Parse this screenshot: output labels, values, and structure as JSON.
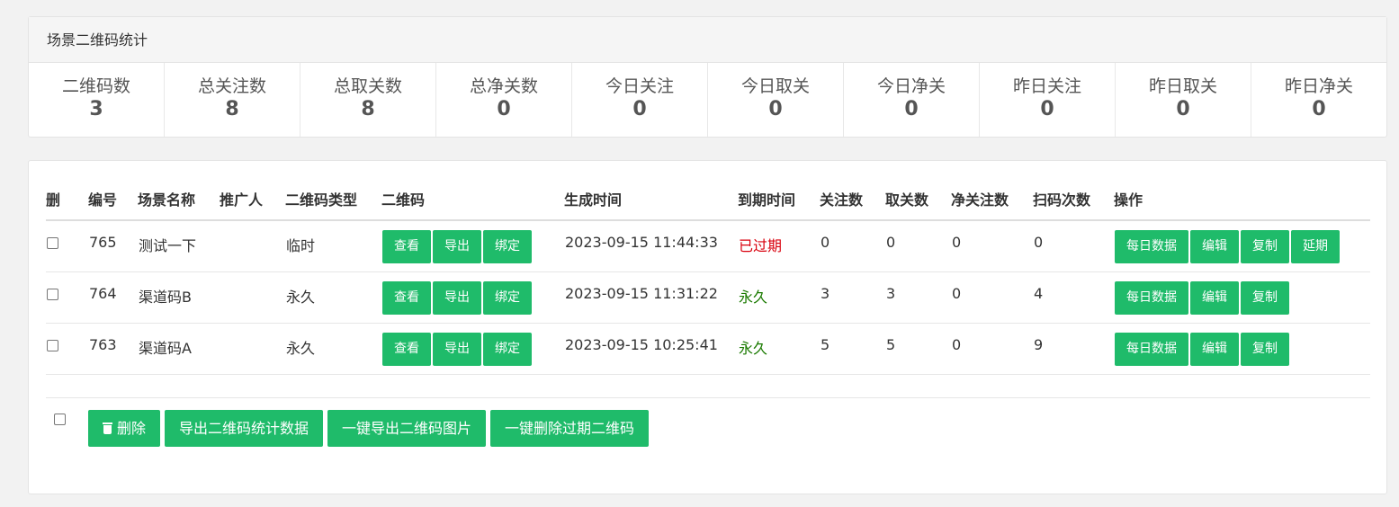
{
  "stats": {
    "title": "场景二维码统计",
    "items": [
      {
        "label": "二维码数",
        "value": "3"
      },
      {
        "label": "总关注数",
        "value": "8"
      },
      {
        "label": "总取关数",
        "value": "8"
      },
      {
        "label": "总净关数",
        "value": "0"
      },
      {
        "label": "今日关注",
        "value": "0"
      },
      {
        "label": "今日取关",
        "value": "0"
      },
      {
        "label": "今日净关",
        "value": "0"
      },
      {
        "label": "昨日关注",
        "value": "0"
      },
      {
        "label": "昨日取关",
        "value": "0"
      },
      {
        "label": "昨日净关",
        "value": "0"
      }
    ]
  },
  "table": {
    "headers": [
      "删",
      "编号",
      "场景名称",
      "推广人",
      "二维码类型",
      "二维码",
      "生成时间",
      "到期时间",
      "关注数",
      "取关数",
      "净关注数",
      "扫码次数",
      "操作"
    ],
    "qr_buttons": {
      "view": "查看",
      "export": "导出",
      "bind": "绑定"
    },
    "action_buttons": {
      "daily": "每日数据",
      "edit": "编辑",
      "copy": "复制",
      "extend": "延期"
    },
    "rows": [
      {
        "id": "765",
        "name": "测试一下",
        "promoter": "",
        "type": "临时",
        "created": "2023-09-15 11:44:33",
        "expire": "已过期",
        "follow": "0",
        "unfollow": "0",
        "net": "0",
        "scans": "0"
      },
      {
        "id": "764",
        "name": "渠道码B",
        "promoter": "",
        "type": "永久",
        "created": "2023-09-15 11:31:22",
        "expire": "永久",
        "follow": "3",
        "unfollow": "3",
        "net": "0",
        "scans": "4"
      },
      {
        "id": "763",
        "name": "渠道码A",
        "promoter": "",
        "type": "永久",
        "created": "2023-09-15 10:25:41",
        "expire": "永久",
        "follow": "5",
        "unfollow": "5",
        "net": "0",
        "scans": "9"
      }
    ]
  },
  "footer": {
    "delete": "删除",
    "export_stats": "导出二维码统计数据",
    "export_images": "一键导出二维码图片",
    "delete_expired": "一键删除过期二维码"
  },
  "colors": {
    "accent": "#1fbb6a",
    "expired": "#d9000d",
    "permanent": "#1a7a00"
  }
}
